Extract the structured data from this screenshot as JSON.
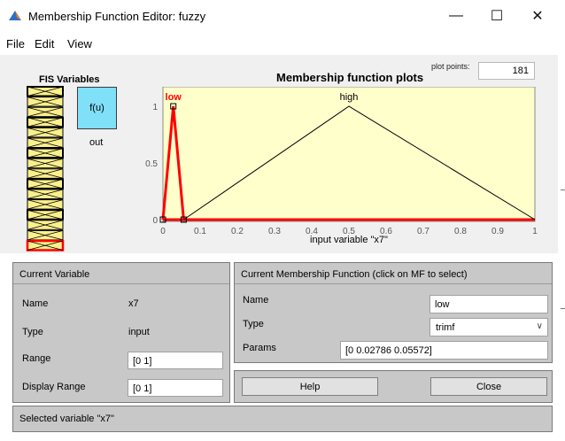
{
  "window": {
    "title": "Membership Function Editor: fuzzy",
    "minimize_glyph": "—",
    "maximize_glyph": "☐",
    "close_glyph": "✕",
    "icon": "matlab-icon"
  },
  "menu": {
    "items": [
      "File",
      "Edit",
      "View"
    ]
  },
  "fis": {
    "title": "FIS Variables",
    "output_block_label": "f(u)",
    "output_name": "out",
    "icons": [
      "input-variable-stack-icon",
      "output-function-icon"
    ],
    "colors": {
      "input": "#fbf08c",
      "output": "#7fe0f7",
      "selected": "#ff0000"
    }
  },
  "plot": {
    "title": "Membership function plots",
    "plot_points_label": "plot points:",
    "plot_points_value": "181",
    "xlabel": "input variable \"x7\"",
    "colors": {
      "background": "#ffffcc",
      "selected_mf": "#ff0000",
      "mf": "#000000"
    }
  },
  "chart_data": {
    "type": "line",
    "title": "Membership function plots",
    "xlabel": "input variable \"x7\"",
    "ylabel": "",
    "xlim": [
      0,
      1
    ],
    "ylim": [
      0,
      1
    ],
    "x_ticks": [
      "0",
      "0.1",
      "0.2",
      "0.3",
      "0.4",
      "0.5",
      "0.6",
      "0.7",
      "0.8",
      "0.9",
      "1"
    ],
    "y_ticks": [
      "0",
      "0.5",
      "1"
    ],
    "series": [
      {
        "name": "low",
        "selected": true,
        "x": [
          0,
          0.02786,
          0.05572
        ],
        "y": [
          0,
          1,
          0
        ]
      },
      {
        "name": "high",
        "selected": false,
        "x": [
          0.05572,
          0.5,
          1
        ],
        "y": [
          0,
          1,
          0
        ]
      }
    ]
  },
  "current_variable": {
    "header": "Current Variable",
    "name_label": "Name",
    "name_value": "x7",
    "type_label": "Type",
    "type_value": "input",
    "range_label": "Range",
    "range_value": "[0 1]",
    "display_range_label": "Display Range",
    "display_range_value": "[0 1]"
  },
  "current_mf": {
    "header": "Current Membership Function (click on MF to select)",
    "name_label": "Name",
    "name_value": "low",
    "type_label": "Type",
    "type_value": "trimf",
    "params_label": "Params",
    "params_value": "[0 0.02786 0.05572]"
  },
  "buttons": {
    "help": "Help",
    "close": "Close"
  },
  "status": {
    "text": "Selected variable \"x7\""
  }
}
